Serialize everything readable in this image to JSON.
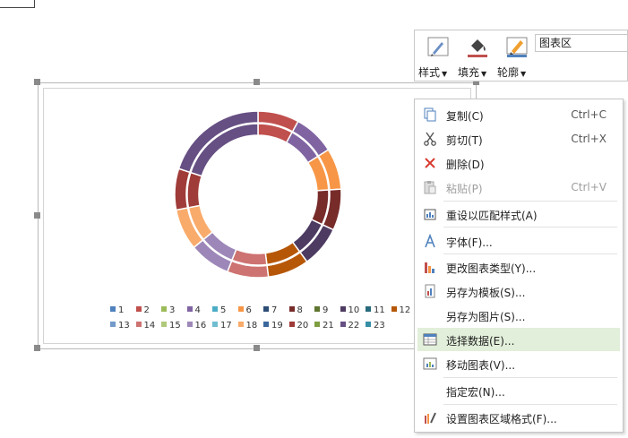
{
  "toolbar": {
    "style_label": "样式",
    "fill_label": "填充",
    "outline_label": "轮廓",
    "element_select_value": "图表区"
  },
  "chart_data": {
    "type": "donut",
    "categories": [
      "1",
      "2",
      "3",
      "4",
      "5",
      "6",
      "7",
      "8",
      "9",
      "10",
      "11",
      "12",
      "13",
      "14",
      "15",
      "16",
      "17",
      "18",
      "19",
      "20",
      "21",
      "22",
      "23"
    ],
    "legend_colors": [
      "#4f81bd",
      "#c0504d",
      "#9bbb59",
      "#8064a2",
      "#4bacc6",
      "#f79646",
      "#2c4d75",
      "#772c2a",
      "#5f7530",
      "#4d3b62",
      "#276a7c",
      "#b65708",
      "#729aca",
      "#cd7371",
      "#afc97a",
      "#9d87b8",
      "#6fbdd1",
      "#f9ab6b",
      "#3a679c",
      "#9f3b38",
      "#7e9d40",
      "#664f83",
      "#358ea6"
    ],
    "visible_segments": [
      {
        "category": "2",
        "value": 1,
        "color": "#c0504d"
      },
      {
        "category": "4",
        "value": 1,
        "color": "#8064a2"
      },
      {
        "category": "6",
        "value": 1,
        "color": "#f79646"
      },
      {
        "category": "8",
        "value": 1,
        "color": "#772c2a"
      },
      {
        "category": "10",
        "value": 1,
        "color": "#4d3b62"
      },
      {
        "category": "12",
        "value": 1,
        "color": "#b65708"
      },
      {
        "category": "14",
        "value": 1,
        "color": "#cd7371"
      },
      {
        "category": "16",
        "value": 1,
        "color": "#9d87b8"
      },
      {
        "category": "18",
        "value": 1,
        "color": "#f9ab6b"
      },
      {
        "category": "20",
        "value": 1,
        "color": "#9f3b38"
      },
      {
        "category": "22",
        "value": 2.5,
        "color": "#664f83"
      }
    ],
    "rings": 2
  },
  "context_menu": {
    "items": [
      {
        "label": "复制(C)",
        "shortcut": "Ctrl+C"
      },
      {
        "label": "剪切(T)",
        "shortcut": "Ctrl+X"
      },
      {
        "label": "删除(D)",
        "shortcut": ""
      },
      {
        "label": "粘贴(P)",
        "shortcut": "Ctrl+V"
      },
      {
        "label": "重设以匹配样式(A)",
        "shortcut": ""
      },
      {
        "label": "字体(F)...",
        "shortcut": ""
      },
      {
        "label": "更改图表类型(Y)...",
        "shortcut": ""
      },
      {
        "label": "另存为模板(S)...",
        "shortcut": ""
      },
      {
        "label": "另存为图片(S)...",
        "shortcut": ""
      },
      {
        "label": "选择数据(E)...",
        "shortcut": ""
      },
      {
        "label": "移动图表(V)...",
        "shortcut": ""
      },
      {
        "label": "指定宏(N)...",
        "shortcut": ""
      },
      {
        "label": "设置图表区域格式(F)...",
        "shortcut": ""
      }
    ]
  }
}
